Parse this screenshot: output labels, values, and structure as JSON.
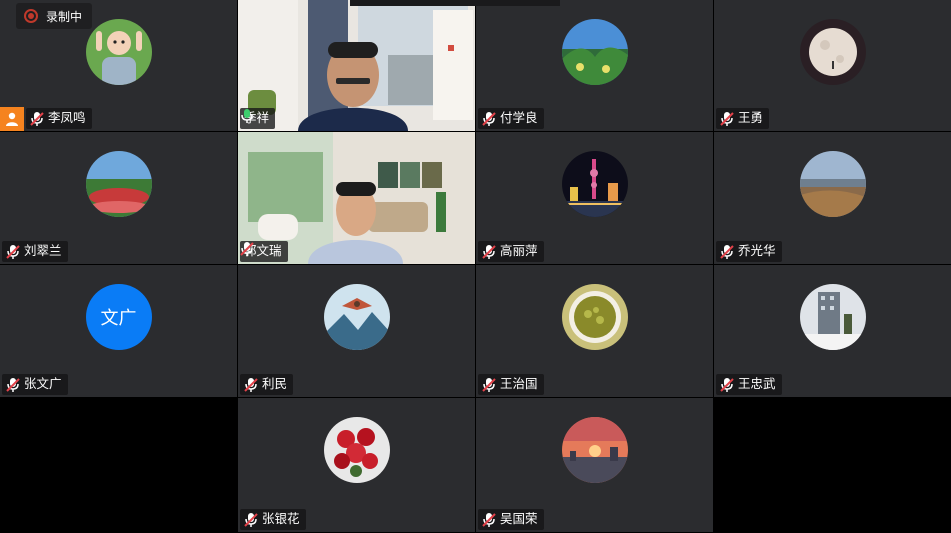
{
  "recording": {
    "label": "录制中"
  },
  "participants": [
    {
      "name": "李凤鸣",
      "mic": "muted",
      "host": true,
      "avatar": "child-photo-avatar"
    },
    {
      "name": "季祥",
      "mic": "speaking",
      "video": "man-in-home-office"
    },
    {
      "name": "付学良",
      "mic": "muted",
      "avatar": "garden-photo-avatar"
    },
    {
      "name": "王勇",
      "mic": "muted",
      "avatar": "moon-photo-avatar"
    },
    {
      "name": "刘翠兰",
      "mic": "muted",
      "avatar": "flower-field-avatar"
    },
    {
      "name": "郭文瑞",
      "mic": "muted",
      "video": "man-in-living-room"
    },
    {
      "name": "高丽萍",
      "mic": "muted",
      "avatar": "night-city-avatar"
    },
    {
      "name": "乔光华",
      "mic": "muted",
      "avatar": "landscape-avatar"
    },
    {
      "name": "张文广",
      "mic": "muted",
      "avatar_text": "文广"
    },
    {
      "name": "利民",
      "mic": "muted",
      "avatar": "eagle-painting-avatar"
    },
    {
      "name": "王治国",
      "mic": "muted",
      "avatar": "tea-cup-avatar"
    },
    {
      "name": "王忠武",
      "mic": "muted",
      "avatar": "building-snow-avatar"
    },
    {
      "name": "张银花",
      "mic": "muted",
      "avatar": "red-roses-avatar"
    },
    {
      "name": "吴国荣",
      "mic": "muted",
      "avatar": "sunset-city-avatar"
    }
  ],
  "colors": {
    "tile_bg": "#2b2c2f",
    "speaking_border": "#2fb36b",
    "host_badge": "#f5831f",
    "text_avatar_bg": "#0a7cf6",
    "muted_mic": "#e2424a"
  }
}
